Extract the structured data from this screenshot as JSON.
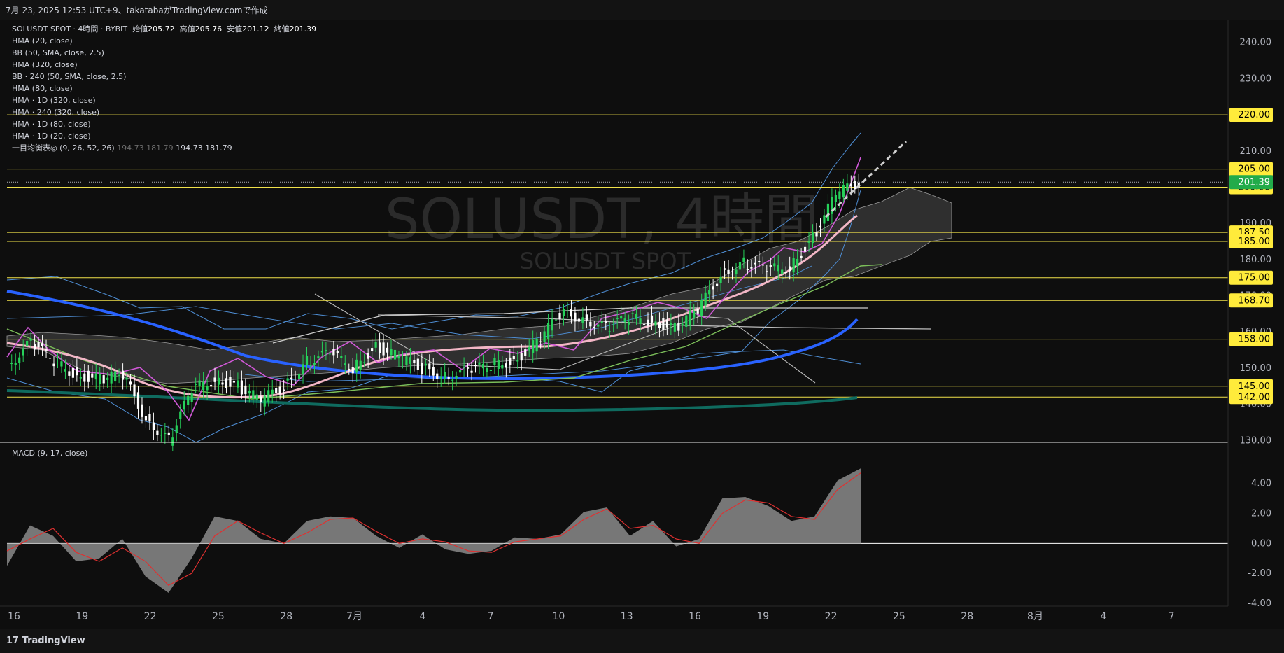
{
  "header": {
    "text": "7月 23, 2025 12:53 UTC+9、takatabaがTradingView.comで作成"
  },
  "legend": {
    "symbol": "SOLUSDT SPOT · 4時間 · BYBIT",
    "ohlc": {
      "open_label": "始値",
      "open": "205.72",
      "high_label": "高値",
      "high": "205.76",
      "low_label": "安値",
      "low": "201.12",
      "close_label": "終値",
      "close": "201.39"
    },
    "indicators": [
      "HMA (20, close)",
      "BB (50, SMA, close, 2.5)",
      "HMA (320, close)",
      "BB · 240 (50, SMA, close, 2.5)",
      "HMA (80, close)",
      "HMA · 1D (320, close)",
      "HMA · 240 (320, close)",
      "HMA · 1D (80, close)",
      "HMA · 1D (20, close)"
    ],
    "ichimoku": {
      "label": "一目均衡表◎ (9, 26, 52, 26)",
      "v1": "194.73",
      "v2": "181.79",
      "v3": "194.73",
      "v4": "181.79"
    }
  },
  "watermark": {
    "main": "SOLUSDT, 4時間",
    "sub": "SOLUSDT SPOT"
  },
  "macd_label": "MACD (9, 17, close)",
  "footer": {
    "brand": "TradingView"
  },
  "colors": {
    "background": "#0e0e0e",
    "hline": "#f0e14a",
    "label_bg": "#ffeb3b",
    "last_price_bg": "#22ab4a",
    "up": "#26d15a",
    "down": "#ffffff",
    "hma_fast": "#d158d8",
    "hma_mid": "#f2b6c6",
    "hma_blue": "#2962ff",
    "hma_teal": "#0f6b5f",
    "bb": "#4f8fd6",
    "macd_signal": "#e03030"
  },
  "chart_data": {
    "type": "line",
    "price_axis": {
      "ticks": [
        "240.00",
        "230.00",
        "220.00",
        "210.00",
        "200.00",
        "190.00",
        "180.00",
        "170.00",
        "160.00",
        "150.00",
        "140.00",
        "130.00"
      ],
      "ylim": [
        126,
        244
      ]
    },
    "time_axis": {
      "ticks": [
        "16",
        "19",
        "22",
        "25",
        "28",
        "7月",
        "4",
        "7",
        "10",
        "13",
        "16",
        "19",
        "22",
        "25",
        "28",
        "8月",
        "4",
        "7"
      ]
    },
    "horizontal_levels": [
      "220.00",
      "205.00",
      "200.00",
      "187.50",
      "185.00",
      "175.00",
      "168.70",
      "158.00",
      "145.00",
      "142.00"
    ],
    "last_price": "201.39",
    "price_series": {
      "name": "SOLUSDT close (approx.)",
      "x": [
        "6/16",
        "6/17",
        "6/18",
        "6/19",
        "6/20",
        "6/21",
        "6/22",
        "6/23",
        "6/24",
        "6/25",
        "6/26",
        "6/27",
        "6/28",
        "6/29",
        "6/30",
        "7/1",
        "7/2",
        "7/3",
        "7/4",
        "7/5",
        "7/6",
        "7/7",
        "7/8",
        "7/9",
        "7/10",
        "7/11",
        "7/12",
        "7/13",
        "7/14",
        "7/15",
        "7/16",
        "7/17",
        "7/18",
        "7/19",
        "7/20",
        "7/21",
        "7/22",
        "7/23"
      ],
      "close": [
        151,
        157,
        152,
        148,
        147,
        148,
        136,
        130,
        144,
        147,
        145,
        141,
        145,
        152,
        154,
        150,
        156,
        153,
        150,
        148,
        149,
        151,
        152,
        157,
        165,
        164,
        161,
        164,
        163,
        161,
        166,
        176,
        179,
        177,
        178,
        186,
        198,
        201.39
      ]
    },
    "macd": {
      "axis_ticks": [
        "4.00",
        "2.00",
        "0.00",
        "-2.00",
        "-4.00"
      ],
      "ylim": [
        -4,
        5.2
      ],
      "histogram": [
        -1.5,
        1.2,
        0.5,
        -1.2,
        -1.0,
        0.3,
        -2.2,
        -3.3,
        -1.0,
        1.8,
        1.5,
        0.3,
        0.0,
        1.5,
        1.8,
        1.7,
        0.5,
        -0.3,
        0.6,
        -0.4,
        -0.7,
        -0.5,
        0.4,
        0.3,
        0.6,
        2.1,
        2.4,
        0.5,
        1.5,
        -0.2,
        0.3,
        3.0,
        3.1,
        2.5,
        1.5,
        1.8,
        4.2,
        5.0
      ],
      "signal": [
        -0.5,
        0.3,
        1.0,
        -0.6,
        -1.2,
        -0.3,
        -1.2,
        -2.8,
        -2.0,
        0.5,
        1.5,
        0.7,
        0.0,
        0.7,
        1.6,
        1.7,
        0.8,
        0.0,
        0.3,
        0.1,
        -0.5,
        -0.6,
        0.1,
        0.3,
        0.5,
        1.6,
        2.3,
        1.0,
        1.2,
        0.3,
        0.0,
        2.0,
        2.9,
        2.7,
        1.8,
        1.6,
        3.6,
        4.7
      ]
    }
  }
}
